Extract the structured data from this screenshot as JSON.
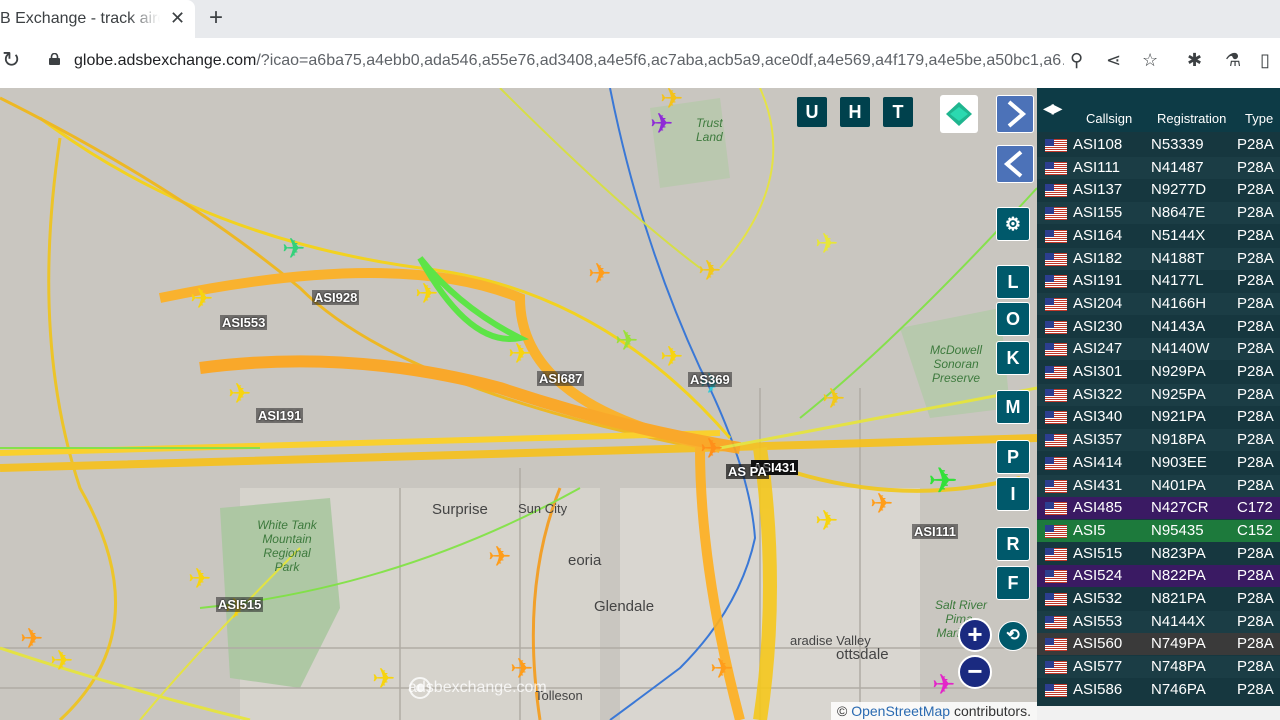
{
  "browser": {
    "tab_title": "B Exchange - track aircraft",
    "tab_close": "✕",
    "new_tab": "+",
    "url_host": "globe.adsbexchange.com",
    "url_path": "/?icao=a6ba75,a4ebb0,ada546,a55e76,ad3408,a4e5f6,ac7aba,acb5a9,ace0df,a4e569,a4f179,a4e5be,a50bc1,a6…"
  },
  "map": {
    "buttons_top": [
      "U",
      "H",
      "T"
    ],
    "side_buttons": [
      "L",
      "O",
      "K",
      "M",
      "P",
      "I",
      "R",
      "F"
    ],
    "aircraft_labels": [
      {
        "text": "ASI928"
      },
      {
        "text": "ASI553"
      },
      {
        "text": "ASI687"
      },
      {
        "text": "ASI191"
      },
      {
        "text": "AS369"
      },
      {
        "text": "ASI431"
      },
      {
        "text": "AS   PA"
      },
      {
        "text": "ASI111"
      },
      {
        "text": "ASI515"
      }
    ],
    "places": {
      "trust": "Trust\nLand",
      "white_tank": "White Tank\nMountain\nRegional\nPark",
      "surprise": "Surprise",
      "sun_city": "Sun City",
      "peoria": "eoria",
      "glendale": "Glendale",
      "paradise_valley": "aradise Valley",
      "scottsdale": "ottsdale",
      "tolleson": "Tolleson",
      "mcdowell": "McDowell\nSonoran\nPreserve",
      "salt_river": "Salt River\nPima-\nMaricopa"
    },
    "watermark": "adsbexchange.com",
    "attribution_prefix": "©",
    "attribution_link": "OpenStreetMap",
    "attribution_suffix": "contributors.",
    "zoom_in": "+",
    "zoom_out": "−"
  },
  "table": {
    "headers": {
      "callsign": "Callsign",
      "registration": "Registration",
      "type": "Type"
    },
    "rows": [
      {
        "callsign": "ASI108",
        "registration": "N53339",
        "type": "P28A",
        "hl": ""
      },
      {
        "callsign": "ASI111",
        "registration": "N41487",
        "type": "P28A",
        "hl": ""
      },
      {
        "callsign": "ASI137",
        "registration": "N9277D",
        "type": "P28A",
        "hl": ""
      },
      {
        "callsign": "ASI155",
        "registration": "N8647E",
        "type": "P28A",
        "hl": ""
      },
      {
        "callsign": "ASI164",
        "registration": "N5144X",
        "type": "P28A",
        "hl": ""
      },
      {
        "callsign": "ASI182",
        "registration": "N4188T",
        "type": "P28A",
        "hl": ""
      },
      {
        "callsign": "ASI191",
        "registration": "N4177L",
        "type": "P28A",
        "hl": ""
      },
      {
        "callsign": "ASI204",
        "registration": "N4166H",
        "type": "P28A",
        "hl": ""
      },
      {
        "callsign": "ASI230",
        "registration": "N4143A",
        "type": "P28A",
        "hl": ""
      },
      {
        "callsign": "ASI247",
        "registration": "N4140W",
        "type": "P28A",
        "hl": ""
      },
      {
        "callsign": "ASI301",
        "registration": "N929PA",
        "type": "P28A",
        "hl": ""
      },
      {
        "callsign": "ASI322",
        "registration": "N925PA",
        "type": "P28A",
        "hl": ""
      },
      {
        "callsign": "ASI340",
        "registration": "N921PA",
        "type": "P28A",
        "hl": ""
      },
      {
        "callsign": "ASI357",
        "registration": "N918PA",
        "type": "P28A",
        "hl": ""
      },
      {
        "callsign": "ASI414",
        "registration": "N903EE",
        "type": "P28A",
        "hl": ""
      },
      {
        "callsign": "ASI431",
        "registration": "N401PA",
        "type": "P28A",
        "hl": ""
      },
      {
        "callsign": "ASI485",
        "registration": "N427CR",
        "type": "C172",
        "hl": "#3a1a63"
      },
      {
        "callsign": "ASI5",
        "registration": "N95435",
        "type": "C152",
        "hl": "#1d7a3c"
      },
      {
        "callsign": "ASI515",
        "registration": "N823PA",
        "type": "P28A",
        "hl": ""
      },
      {
        "callsign": "ASI524",
        "registration": "N822PA",
        "type": "P28A",
        "hl": "#3a1a63"
      },
      {
        "callsign": "ASI532",
        "registration": "N821PA",
        "type": "P28A",
        "hl": ""
      },
      {
        "callsign": "ASI553",
        "registration": "N4144X",
        "type": "P28A",
        "hl": ""
      },
      {
        "callsign": "ASI560",
        "registration": "N749PA",
        "type": "P28A",
        "hl": "#3a3a3a"
      },
      {
        "callsign": "ASI577",
        "registration": "N748PA",
        "type": "P28A",
        "hl": ""
      },
      {
        "callsign": "ASI586",
        "registration": "N746PA",
        "type": "P28A",
        "hl": ""
      }
    ]
  }
}
